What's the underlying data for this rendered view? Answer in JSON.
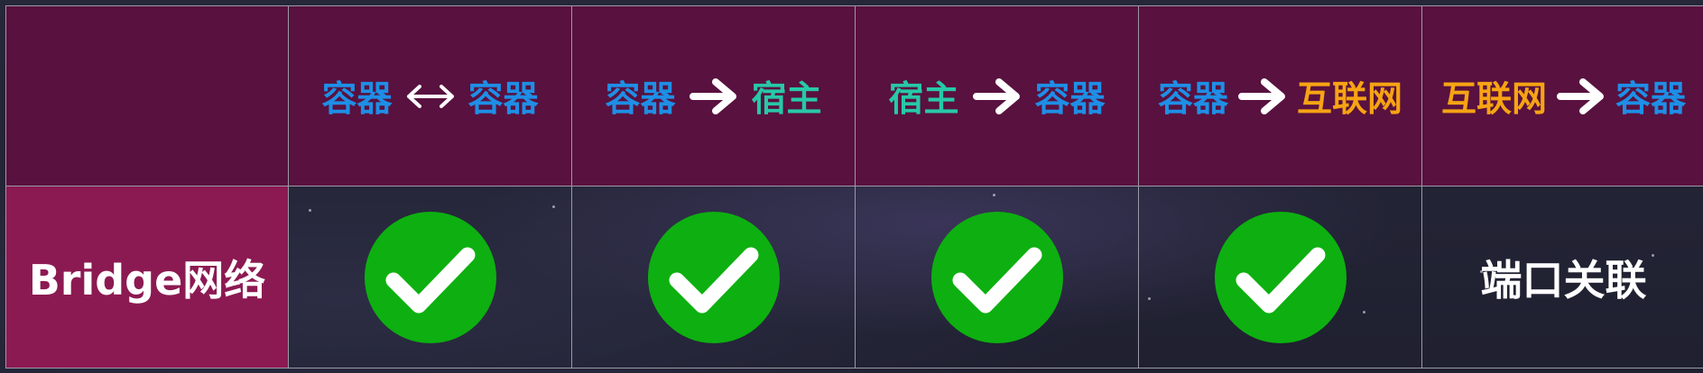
{
  "colors": {
    "container": "#1e8fe6",
    "host": "#27c9a6",
    "internet": "#f6a413",
    "arrow": "#ffffff",
    "header_bg": "#59113f",
    "row_label_bg": "#8c1a52",
    "check_green": "#0db010"
  },
  "columns": [
    {
      "from": "容器",
      "from_kind": "container",
      "arrow": "both",
      "to": "容器",
      "to_kind": "container"
    },
    {
      "from": "容器",
      "from_kind": "container",
      "arrow": "right",
      "to": "宿主",
      "to_kind": "host"
    },
    {
      "from": "宿主",
      "from_kind": "host",
      "arrow": "right",
      "to": "容器",
      "to_kind": "container"
    },
    {
      "from": "容器",
      "from_kind": "container",
      "arrow": "right",
      "to": "互联网",
      "to_kind": "internet"
    },
    {
      "from": "互联网",
      "from_kind": "internet",
      "arrow": "right",
      "to": "容器",
      "to_kind": "container"
    }
  ],
  "rows": [
    {
      "label": "Bridge网络",
      "cells": [
        {
          "type": "check",
          "icon": "check-circle-icon"
        },
        {
          "type": "check",
          "icon": "check-circle-icon"
        },
        {
          "type": "check",
          "icon": "check-circle-icon"
        },
        {
          "type": "check",
          "icon": "check-circle-icon"
        },
        {
          "type": "text",
          "text": "端口关联"
        }
      ]
    }
  ]
}
